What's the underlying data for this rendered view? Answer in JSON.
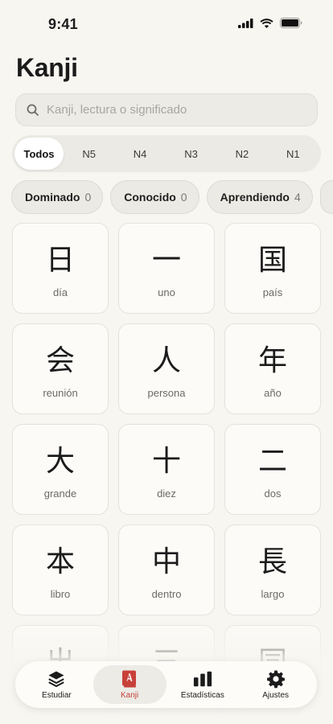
{
  "status": {
    "time": "9:41"
  },
  "title": "Kanji",
  "search": {
    "placeholder": "Kanji, lectura o significado",
    "value": ""
  },
  "levels": [
    {
      "label": "Todos",
      "active": true
    },
    {
      "label": "N5"
    },
    {
      "label": "N4"
    },
    {
      "label": "N3"
    },
    {
      "label": "N2"
    },
    {
      "label": "N1"
    }
  ],
  "filters": [
    {
      "label": "Dominado",
      "count": "0"
    },
    {
      "label": "Conocido",
      "count": "0"
    },
    {
      "label": "Aprendiendo",
      "count": "4"
    }
  ],
  "cards": [
    {
      "kanji": "日",
      "meaning": "día"
    },
    {
      "kanji": "一",
      "meaning": "uno"
    },
    {
      "kanji": "国",
      "meaning": "país"
    },
    {
      "kanji": "会",
      "meaning": "reunión"
    },
    {
      "kanji": "人",
      "meaning": "persona"
    },
    {
      "kanji": "年",
      "meaning": "año"
    },
    {
      "kanji": "大",
      "meaning": "grande"
    },
    {
      "kanji": "十",
      "meaning": "diez"
    },
    {
      "kanji": "二",
      "meaning": "dos"
    },
    {
      "kanji": "本",
      "meaning": "libro"
    },
    {
      "kanji": "中",
      "meaning": "dentro"
    },
    {
      "kanji": "長",
      "meaning": "largo"
    },
    {
      "kanji": "出",
      "meaning": ""
    },
    {
      "kanji": "三",
      "meaning": ""
    },
    {
      "kanji": "同",
      "meaning": ""
    }
  ],
  "tabs": [
    {
      "label": "Estudiar",
      "icon": "stack-icon"
    },
    {
      "label": "Kanji",
      "icon": "kanji-book-icon",
      "active": true
    },
    {
      "label": "Estadísticas",
      "icon": "bar-chart-icon"
    },
    {
      "label": "Ajustes",
      "icon": "gear-icon"
    }
  ],
  "colors": {
    "accent": "#c8403a",
    "background": "#f7f6f1"
  }
}
